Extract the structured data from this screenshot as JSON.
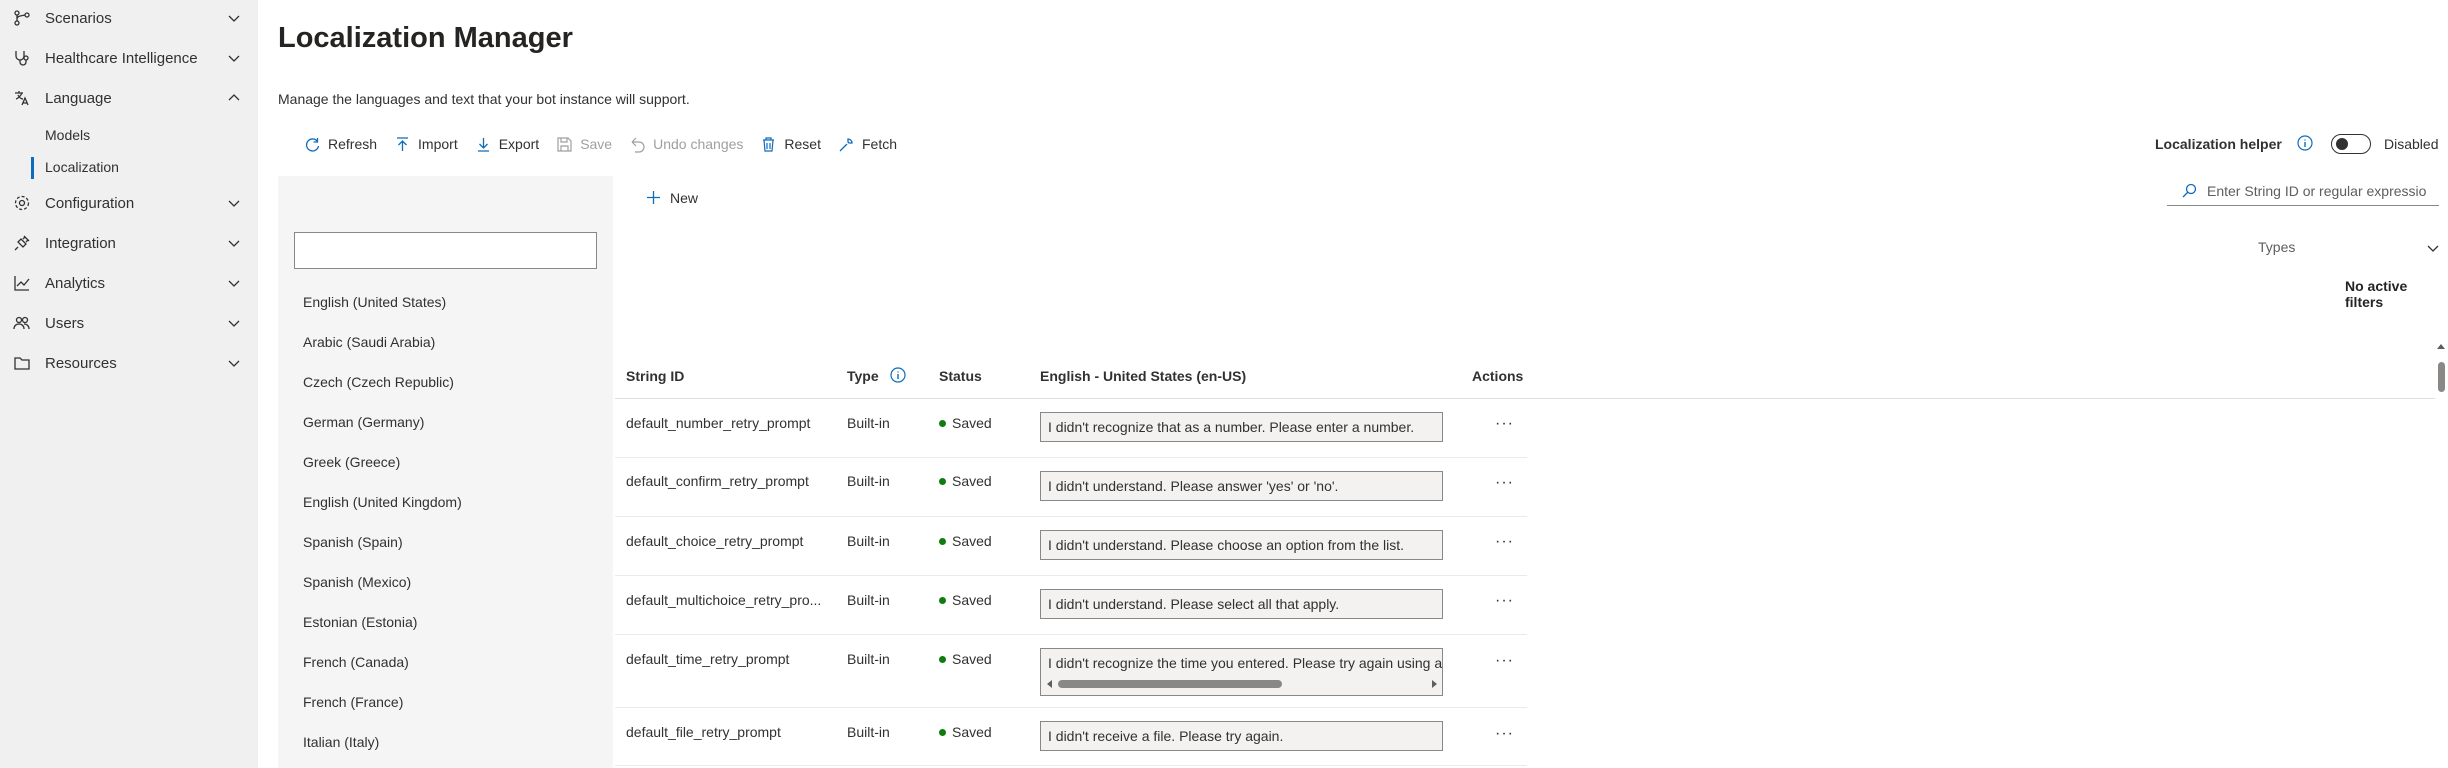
{
  "nav": {
    "items": [
      {
        "label": "Scenarios",
        "icon": "scenarios-icon",
        "expanded": false
      },
      {
        "label": "Healthcare Intelligence",
        "icon": "stethoscope-icon",
        "expanded": false
      },
      {
        "label": "Language",
        "icon": "language-icon",
        "expanded": true
      },
      {
        "label": "Configuration",
        "icon": "gear-icon",
        "expanded": false
      },
      {
        "label": "Integration",
        "icon": "plug-icon",
        "expanded": false
      },
      {
        "label": "Analytics",
        "icon": "analytics-icon",
        "expanded": false
      },
      {
        "label": "Users",
        "icon": "users-icon",
        "expanded": false
      },
      {
        "label": "Resources",
        "icon": "folder-icon",
        "expanded": false
      }
    ],
    "language_sub": [
      "Models",
      "Localization"
    ],
    "selected_sub": "Localization"
  },
  "page": {
    "title": "Localization Manager",
    "description": "Manage the languages and text that your bot instance will support."
  },
  "toolbar": {
    "refresh": "Refresh",
    "import": "Import",
    "export": "Export",
    "save": "Save",
    "undo": "Undo changes",
    "reset": "Reset",
    "fetch": "Fetch"
  },
  "helper": {
    "label": "Localization helper",
    "state": "Disabled"
  },
  "languages": [
    "English (United States)",
    "Arabic (Saudi Arabia)",
    "Czech (Czech Republic)",
    "German (Germany)",
    "Greek (Greece)",
    "English (United Kingdom)",
    "Spanish (Spain)",
    "Spanish (Mexico)",
    "Estonian (Estonia)",
    "French (Canada)",
    "French (France)",
    "Italian (Italy)"
  ],
  "new_label": "New",
  "search": {
    "placeholder": "Enter String ID or regular expression"
  },
  "filters": {
    "types_label": "Types",
    "active": "No active filters"
  },
  "table": {
    "headers": {
      "string_id": "String ID",
      "type": "Type",
      "status": "Status",
      "english": "English - United States (en-US)",
      "actions": "Actions"
    },
    "rows": [
      {
        "id": "default_number_retry_prompt",
        "type": "Built-in",
        "status": "Saved",
        "value": "I didn't recognize that as a number. Please enter a number."
      },
      {
        "id": "default_confirm_retry_prompt",
        "type": "Built-in",
        "status": "Saved",
        "value": "I didn't understand. Please answer 'yes' or 'no'."
      },
      {
        "id": "default_choice_retry_prompt",
        "type": "Built-in",
        "status": "Saved",
        "value": "I didn't understand. Please choose an option from the list."
      },
      {
        "id": "default_multichoice_retry_pro...",
        "type": "Built-in",
        "status": "Saved",
        "value": "I didn't understand. Please select all that apply."
      },
      {
        "id": "default_time_retry_prompt",
        "type": "Built-in",
        "status": "Saved",
        "value": "I didn't recognize the time you entered. Please try again using a"
      },
      {
        "id": "default_file_retry_prompt",
        "type": "Built-in",
        "status": "Saved",
        "value": "I didn't receive a file. Please try again."
      }
    ],
    "actions_glyph": "···"
  },
  "colors": {
    "accent": "#0f6cbd",
    "saved": "#107c10",
    "nav_bg": "#f0f0f0"
  }
}
